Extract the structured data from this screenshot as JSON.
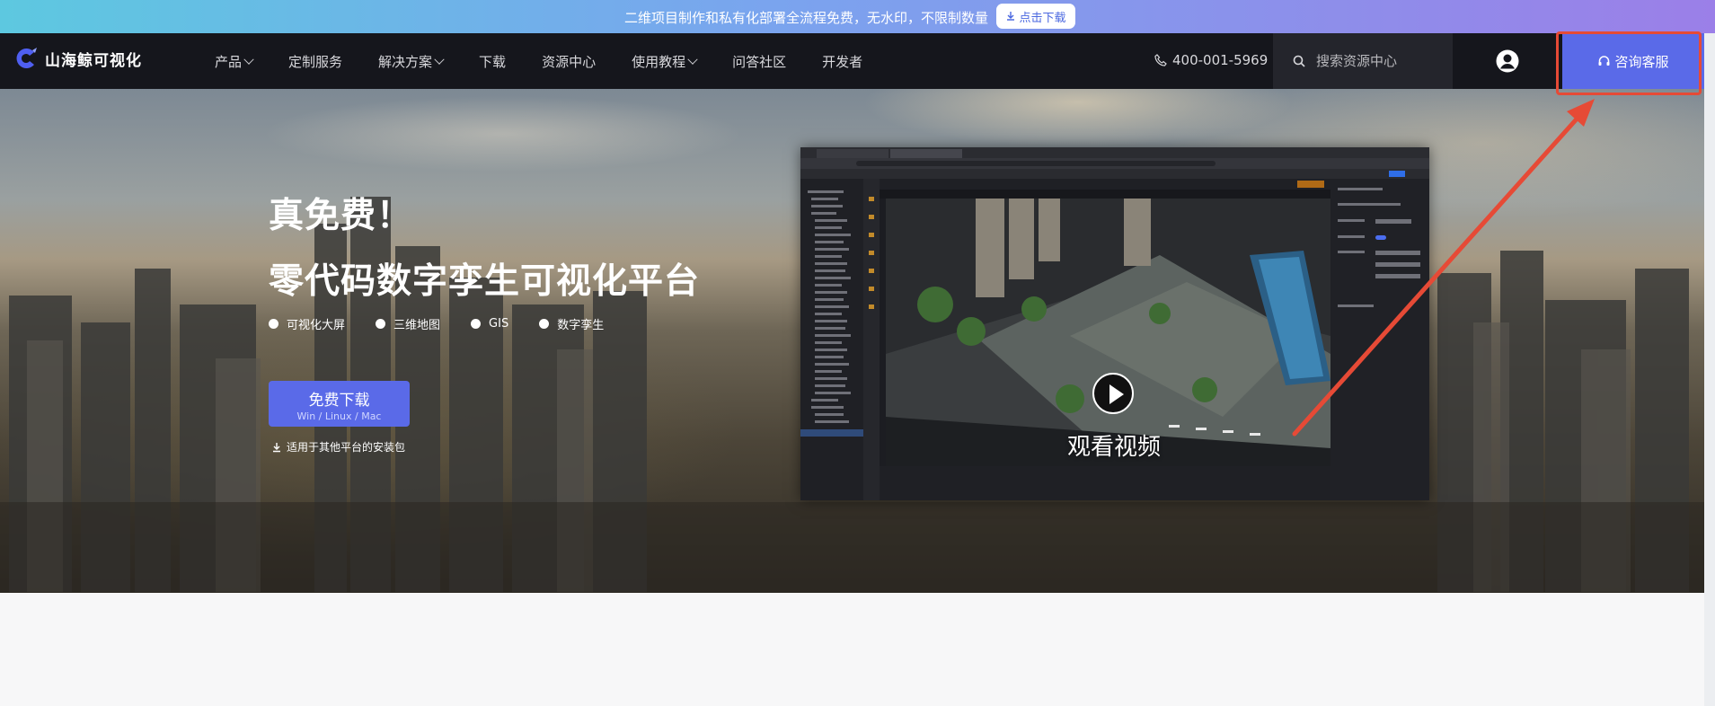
{
  "promo": {
    "text": "二维项目制作和私有化部署全流程免费，无水印，不限制数量",
    "button_label": "点击下载",
    "colors": [
      "#5dc8e0",
      "#9b7fe8"
    ]
  },
  "nav": {
    "logo_text": "山海鲸可视化",
    "items": [
      {
        "label": "产品",
        "dropdown": true
      },
      {
        "label": "定制服务",
        "dropdown": false
      },
      {
        "label": "解决方案",
        "dropdown": true
      },
      {
        "label": "下载",
        "dropdown": false
      },
      {
        "label": "资源中心",
        "dropdown": false
      },
      {
        "label": "使用教程",
        "dropdown": true
      },
      {
        "label": "问答社区",
        "dropdown": false
      },
      {
        "label": "开发者",
        "dropdown": false
      }
    ],
    "phone": "400-001-5969",
    "search_placeholder": "搜索资源中心",
    "consult_label": "咨询客服",
    "accent": "#5a6ae8"
  },
  "hero": {
    "title1": "真免费！",
    "title2": "零代码数字孪生可视化平台",
    "tags": [
      "可视化大屏",
      "三维地图",
      "GIS",
      "数字孪生"
    ],
    "download_label": "免费下载",
    "download_sub": "Win / Linux / Mac",
    "other_platforms": "适用于其他平台的安装包",
    "video_label": "观看视频"
  },
  "annotation": {
    "color": "#e64a36",
    "target": "咨询客服"
  }
}
